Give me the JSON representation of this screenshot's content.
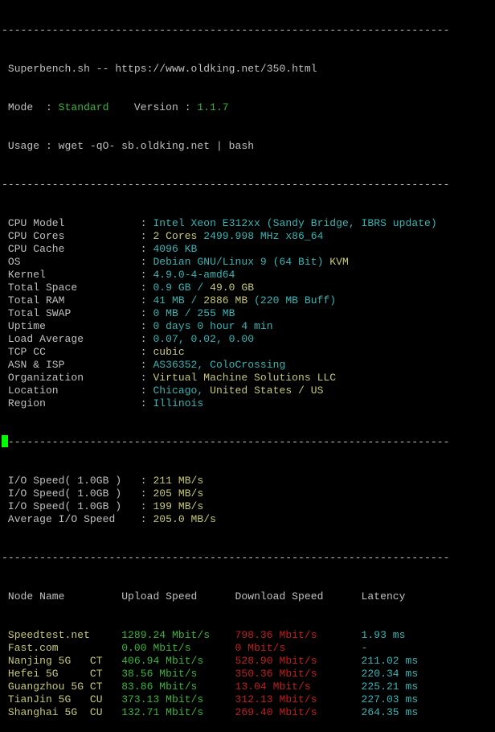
{
  "colors": {
    "gray": "#c0c0c0",
    "green": "#3cb43c",
    "yellow": "#c8c878",
    "cyan": "#3ab4b4",
    "red": "#c02020",
    "cursor": "#00ff00",
    "background": "#000000"
  },
  "separator": "-----------------------------------------------------------------------",
  "header": {
    "title": " Superbench.sh -- https://www.oldking.net/350.html",
    "mode_label": " Mode  : ",
    "mode_value": "Standard",
    "version_label": "    Version : ",
    "version_value": "1.1.7",
    "usage": " Usage : wget -qO- sb.oldking.net | bash"
  },
  "system_info": [
    {
      "label": " CPU Model            : ",
      "segments": [
        {
          "text": "Intel Xeon E312xx (Sandy Bridge, IBRS update)",
          "color": "cyan"
        }
      ]
    },
    {
      "label": " CPU Cores            : ",
      "segments": [
        {
          "text": "2 Cores ",
          "color": "yellow"
        },
        {
          "text": "2499.998 MHz x86_64",
          "color": "cyan"
        }
      ]
    },
    {
      "label": " CPU Cache            : ",
      "segments": [
        {
          "text": "4096 KB",
          "color": "cyan"
        }
      ]
    },
    {
      "label": " OS                   : ",
      "segments": [
        {
          "text": "Debian GNU/Linux 9 (64 Bit) ",
          "color": "cyan"
        },
        {
          "text": "KVM",
          "color": "yellow"
        }
      ]
    },
    {
      "label": " Kernel               : ",
      "segments": [
        {
          "text": "4.9.0-4-amd64",
          "color": "cyan"
        }
      ]
    },
    {
      "label": " Total Space          : ",
      "segments": [
        {
          "text": "0.9 GB / ",
          "color": "cyan"
        },
        {
          "text": "49.0 GB",
          "color": "yellow"
        }
      ]
    },
    {
      "label": " Total RAM            : ",
      "segments": [
        {
          "text": "41 MB / ",
          "color": "cyan"
        },
        {
          "text": "2886 MB",
          "color": "yellow"
        },
        {
          "text": " (220 MB Buff)",
          "color": "cyan"
        }
      ]
    },
    {
      "label": " Total SWAP           : ",
      "segments": [
        {
          "text": "0 MB / 255 MB",
          "color": "cyan"
        }
      ]
    },
    {
      "label": " Uptime               : ",
      "segments": [
        {
          "text": "0 days 0 hour 4 min",
          "color": "cyan"
        }
      ]
    },
    {
      "label": " Load Average         : ",
      "segments": [
        {
          "text": "0.07, 0.02, 0.00",
          "color": "cyan"
        }
      ]
    },
    {
      "label": " TCP CC               : ",
      "segments": [
        {
          "text": "cubic",
          "color": "yellow"
        }
      ]
    },
    {
      "label": " ASN & ISP            : ",
      "segments": [
        {
          "text": "AS36352, ColoCrossing",
          "color": "cyan"
        }
      ]
    },
    {
      "label": " Organization         : ",
      "segments": [
        {
          "text": "Virtual Machine Solutions LLC",
          "color": "yellow"
        }
      ]
    },
    {
      "label": " Location             : ",
      "segments": [
        {
          "text": "Chicago, ",
          "color": "cyan"
        },
        {
          "text": "United States / US",
          "color": "yellow"
        }
      ]
    },
    {
      "label": " Region               : ",
      "segments": [
        {
          "text": "Illinois",
          "color": "cyan"
        }
      ]
    }
  ],
  "io": [
    {
      "label": " I/O Speed( 1.0GB )   : ",
      "value": "211 MB/s"
    },
    {
      "label": " I/O Speed( 1.0GB )   : ",
      "value": "205 MB/s"
    },
    {
      "label": " I/O Speed( 1.0GB )   : ",
      "value": "199 MB/s"
    },
    {
      "label": " Average I/O Speed    : ",
      "value": "205.0 MB/s"
    }
  ],
  "speed_table": {
    "headers": [
      " Node Name         ",
      "Upload Speed      ",
      "Download Speed      ",
      "Latency"
    ],
    "rows": [
      {
        "node": " Speedtest.net     ",
        "upload": "1289.24 Mbit/s    ",
        "download": "798.36 Mbit/s       ",
        "latency": "1.93 ms"
      },
      {
        "node": " Fast.com          ",
        "upload": "0.00 Mbit/s       ",
        "download": "0 Mbit/s            ",
        "latency": "-"
      },
      {
        "node": " Nanjing 5G   CT   ",
        "upload": "406.94 Mbit/s     ",
        "download": "528.90 Mbit/s       ",
        "latency": "211.02 ms"
      },
      {
        "node": " Hefei 5G     CT   ",
        "upload": "38.56 Mbit/s      ",
        "download": "350.36 Mbit/s       ",
        "latency": "220.34 ms"
      },
      {
        "node": " Guangzhou 5G CT   ",
        "upload": "83.86 Mbit/s      ",
        "download": "13.04 Mbit/s        ",
        "latency": "225.21 ms"
      },
      {
        "node": " TianJin 5G   CU   ",
        "upload": "373.13 Mbit/s     ",
        "download": "312.13 Mbit/s       ",
        "latency": "227.03 ms"
      },
      {
        "node": " Shanghai 5G  CU   ",
        "upload": "132.71 Mbit/s     ",
        "download": "269.40 Mbit/s       ",
        "latency": "264.35 ms"
      }
    ]
  }
}
